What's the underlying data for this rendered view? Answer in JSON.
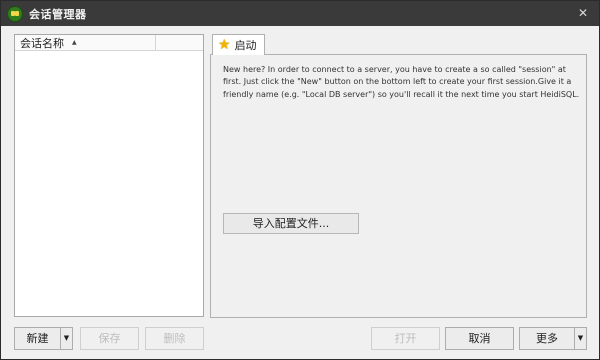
{
  "window": {
    "title": "会话管理器",
    "close_glyph": "✕"
  },
  "session_list": {
    "column_name": "会话名称",
    "sort_glyph": "▲",
    "items": []
  },
  "tab": {
    "label": "启动",
    "icon": "star-icon",
    "icon_glyph": "★"
  },
  "intro": {
    "text": "New here? In order to connect to a server, you have to create a so called \"session\" at first. Just click the \"New\" button on the bottom left to create your first session.Give it a friendly name (e.g. \"Local DB server\") so you'll recall it the next time you start HeidiSQL."
  },
  "import_button": {
    "label": "导入配置文件..."
  },
  "buttons": {
    "new": "新建",
    "save": "保存",
    "delete": "删除",
    "open": "打开",
    "cancel": "取消",
    "more": "更多",
    "dropdown_glyph": "▼"
  },
  "colors": {
    "titlebar": "#3a3a3a",
    "window_bg": "#f0f0f0",
    "star": "#f2b400"
  }
}
